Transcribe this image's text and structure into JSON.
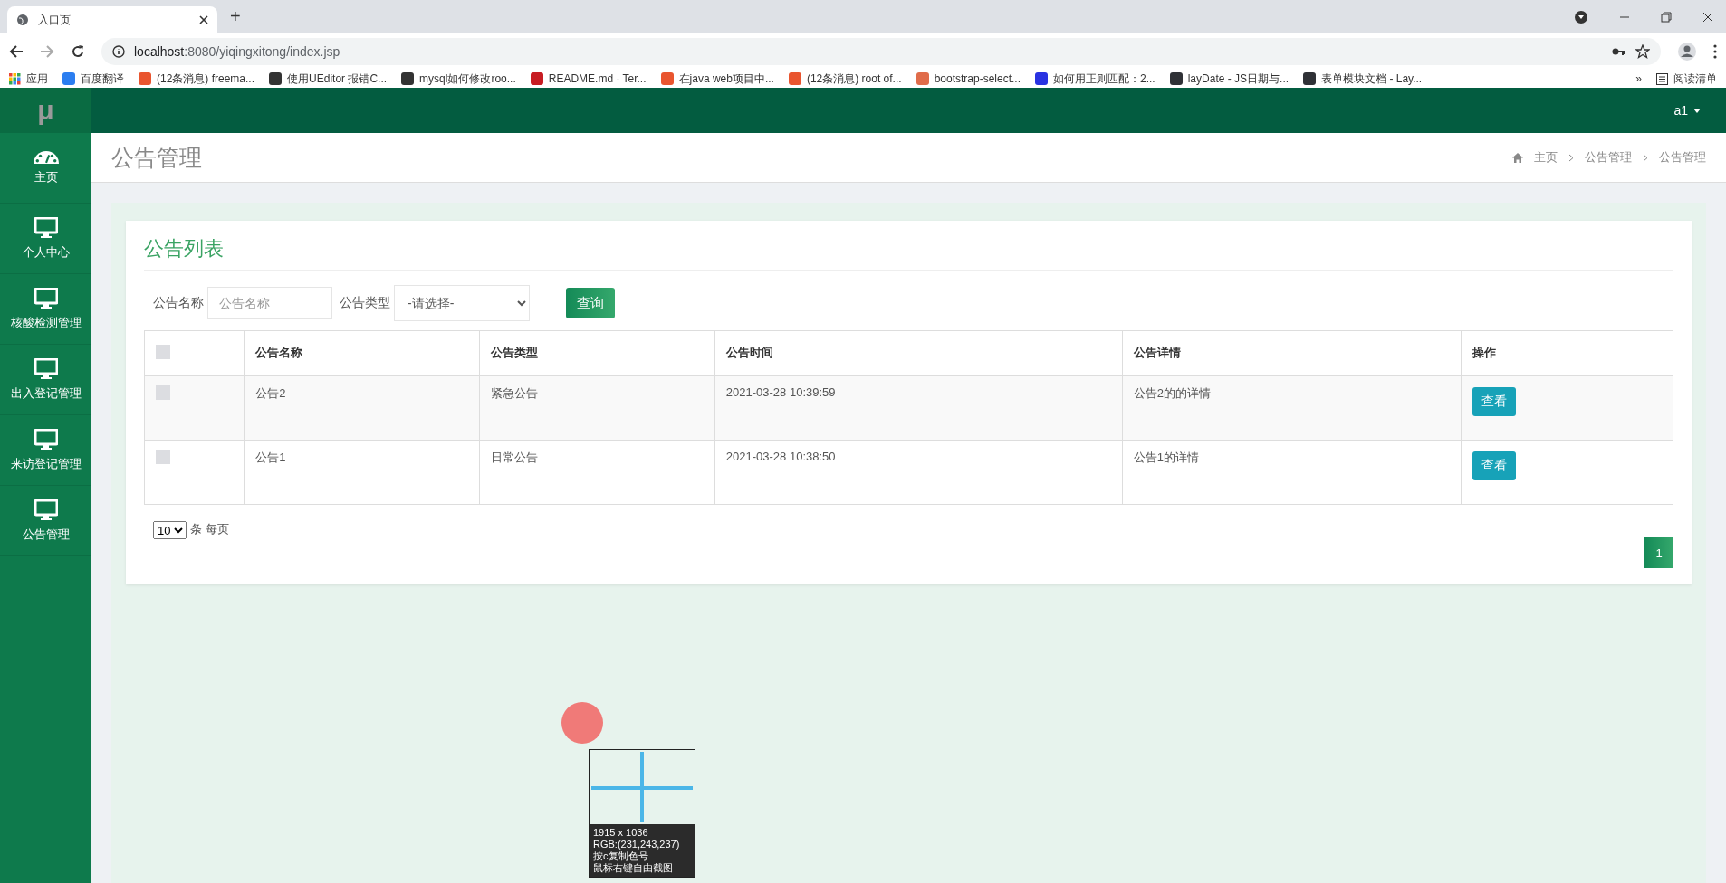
{
  "browser": {
    "tab_title": "入口页",
    "new_tab": "+",
    "url_host": "localhost",
    "url_rest": ":8080/yiqingxitong/index.jsp",
    "apps_label": "应用",
    "bookmarks": [
      {
        "label": "百度翻译",
        "color": "#2b7ef0"
      },
      {
        "label": "(12条消息) freema...",
        "color": "#e9552f"
      },
      {
        "label": "使用UEditor 报错C...",
        "color": "#333333"
      },
      {
        "label": "mysql如何修改roo...",
        "color": "#333333"
      },
      {
        "label": "README.md · Ter...",
        "color": "#c71d23"
      },
      {
        "label": "在java web项目中...",
        "color": "#e9552f"
      },
      {
        "label": "(12条消息) root of...",
        "color": "#e9552f"
      },
      {
        "label": "bootstrap-select...",
        "color": "#e06c4a"
      },
      {
        "label": "如何用正则匹配：2...",
        "color": "#2932e1"
      },
      {
        "label": "layDate - JS日期与...",
        "color": "#2f3136"
      },
      {
        "label": "表单模块文档 - Lay...",
        "color": "#2f3136"
      }
    ],
    "overflow": "»",
    "reading_list": "阅读清单"
  },
  "header": {
    "logo": "μ",
    "user": "a1"
  },
  "sidebar": {
    "items": [
      {
        "label": "主页",
        "kind": "dashboard"
      },
      {
        "label": "个人中心",
        "kind": "module"
      },
      {
        "label": "核酸检测管理",
        "kind": "module"
      },
      {
        "label": "出入登记管理",
        "kind": "module"
      },
      {
        "label": "来访登记管理",
        "kind": "module"
      },
      {
        "label": "公告管理",
        "kind": "module"
      }
    ]
  },
  "page": {
    "title": "公告管理",
    "breadcrumb": [
      "主页",
      "公告管理",
      "公告管理"
    ]
  },
  "card": {
    "title": "公告列表",
    "filters": [
      {
        "label": "公告名称",
        "kind": "input",
        "placeholder": "公告名称"
      },
      {
        "label": "公告类型",
        "kind": "select",
        "value": "-请选择-"
      }
    ],
    "search_button": "查询",
    "table": {
      "header_checked": false,
      "columns": [
        "公告名称",
        "公告类型",
        "公告时间",
        "公告详情",
        "操作"
      ],
      "rows": [
        {
          "checked": false,
          "cells": [
            "公告2",
            "紧急公告",
            "2021-03-28 10:39:59",
            "公告2的的详情"
          ],
          "action": "查看"
        },
        {
          "checked": false,
          "cells": [
            "公告1",
            "日常公告",
            "2021-03-28 10:38:50",
            "公告1的详情"
          ],
          "action": "查看"
        }
      ]
    },
    "page_size": "10",
    "page_size_label": "条 每页",
    "pages": [
      {
        "label": "1",
        "selected": true
      }
    ]
  },
  "capture_tool": {
    "lines": [
      "1915 x 1036",
      "RGB:(231,243,237)",
      "按c复制色号",
      "鼠标右键自由截图"
    ]
  }
}
